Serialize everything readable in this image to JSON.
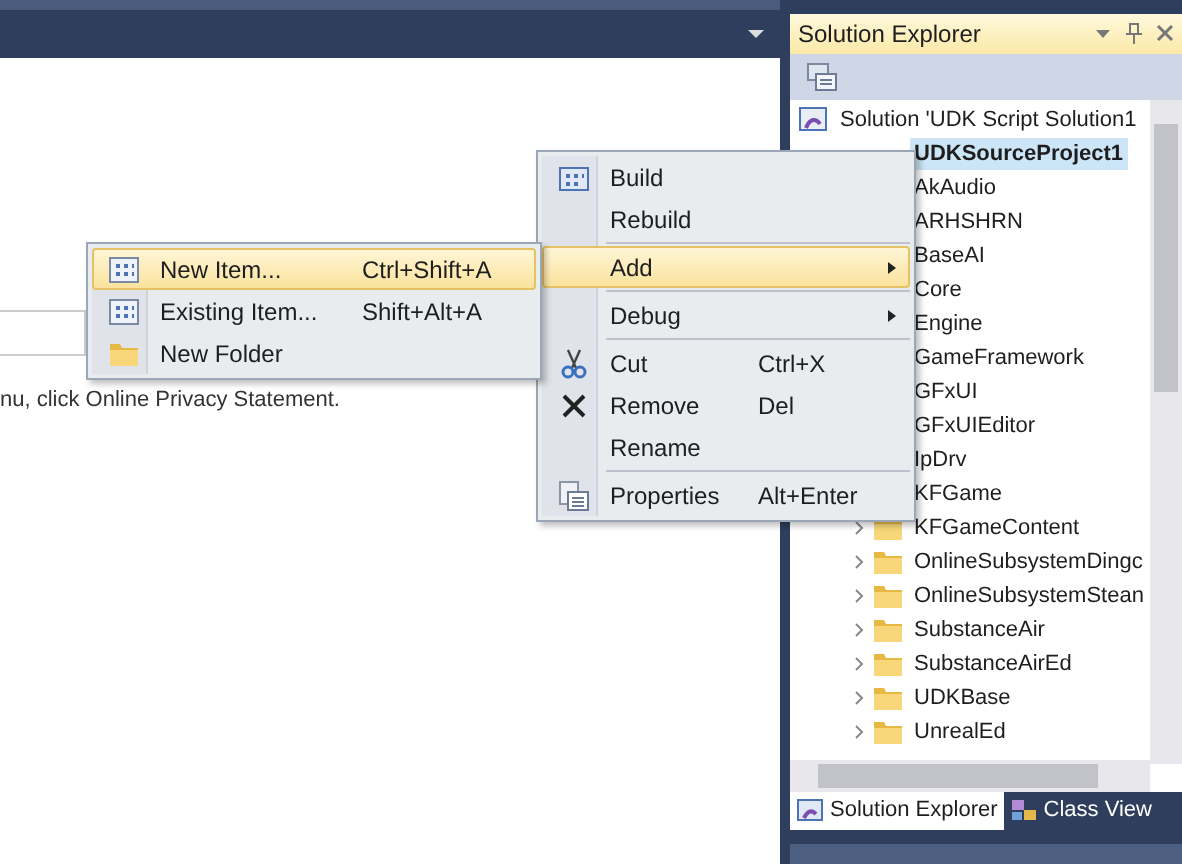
{
  "document": {
    "text": "nu, click Online Privacy Statement."
  },
  "solution_explorer": {
    "title": "Solution Explorer",
    "tree": [
      {
        "kind": "solution",
        "label": "Solution 'UDK Script Solution1",
        "selected": false,
        "children": [
          {
            "kind": "project",
            "label": "UDKSourceProject1",
            "selected": true,
            "children": [
              {
                "kind": "node",
                "label": "AkAudio",
                "selected": false
              },
              {
                "kind": "node",
                "label": "ARHSHRN",
                "selected": false
              },
              {
                "kind": "node",
                "label": "BaseAI",
                "selected": false
              },
              {
                "kind": "node",
                "label": "Core",
                "selected": false
              },
              {
                "kind": "node",
                "label": "Engine",
                "selected": false
              },
              {
                "kind": "node",
                "label": "GameFramework",
                "selected": false
              },
              {
                "kind": "node",
                "label": "GFxUI",
                "selected": false
              },
              {
                "kind": "node",
                "label": "GFxUIEditor",
                "selected": false
              },
              {
                "kind": "node",
                "label": "IpDrv",
                "selected": false
              },
              {
                "kind": "node",
                "label": "KFGame",
                "selected": false
              },
              {
                "kind": "folder",
                "label": "KFGameContent",
                "selected": false,
                "expanded": false
              },
              {
                "kind": "folder",
                "label": "OnlineSubsystemDingc",
                "selected": false,
                "expanded": false
              },
              {
                "kind": "folder",
                "label": "OnlineSubsystemStean",
                "selected": false,
                "expanded": false
              },
              {
                "kind": "folder",
                "label": "SubstanceAir",
                "selected": false,
                "expanded": false
              },
              {
                "kind": "folder",
                "label": "SubstanceAirEd",
                "selected": false,
                "expanded": false
              },
              {
                "kind": "folder",
                "label": "UDKBase",
                "selected": false,
                "expanded": false
              },
              {
                "kind": "folder",
                "label": "UnrealEd",
                "selected": false,
                "expanded": false
              }
            ]
          }
        ]
      }
    ],
    "tabs": [
      {
        "label": "Solution Explorer",
        "selected": true
      },
      {
        "label": "Class View",
        "selected": false
      }
    ]
  },
  "context_menu": [
    {
      "kind": "item",
      "label": "Build",
      "selected": false
    },
    {
      "kind": "item",
      "label": "Rebuild",
      "selected": false
    },
    {
      "kind": "separator"
    },
    {
      "kind": "item",
      "label": "Add",
      "selected": true,
      "submenu": true
    },
    {
      "kind": "separator"
    },
    {
      "kind": "item",
      "label": "Debug",
      "selected": false,
      "submenu": true
    },
    {
      "kind": "separator"
    },
    {
      "kind": "item",
      "label": "Cut",
      "shortcut": "Ctrl+X",
      "selected": false
    },
    {
      "kind": "item",
      "label": "Remove",
      "shortcut": "Del",
      "selected": false
    },
    {
      "kind": "item",
      "label": "Rename",
      "selected": false
    },
    {
      "kind": "separator"
    },
    {
      "kind": "item",
      "label": "Properties",
      "shortcut": "Alt+Enter",
      "selected": false
    }
  ],
  "add_submenu": [
    {
      "kind": "item",
      "label": "New Item...",
      "shortcut": "Ctrl+Shift+A",
      "selected": true
    },
    {
      "kind": "item",
      "label": "Existing Item...",
      "shortcut": "Shift+Alt+A",
      "selected": false
    },
    {
      "kind": "item",
      "label": "New Folder",
      "selected": false
    }
  ]
}
